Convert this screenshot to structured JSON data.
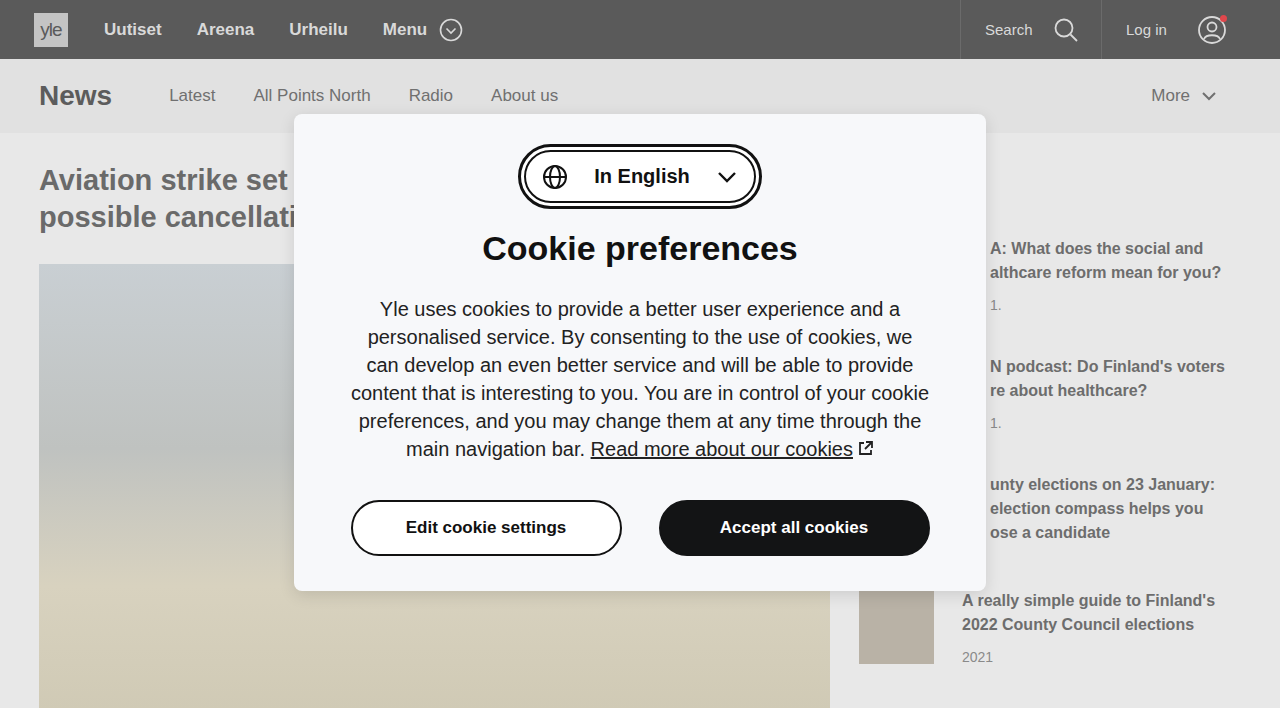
{
  "topbar": {
    "logo": "yle",
    "nav": [
      {
        "label": "Uutiset"
      },
      {
        "label": "Areena"
      },
      {
        "label": "Urheilu"
      }
    ],
    "menu": "Menu",
    "search": "Search",
    "login": {
      "label": "Log in",
      "notification": true
    }
  },
  "section": {
    "title": "News",
    "links": [
      "Latest",
      "All Points North",
      "Radio",
      "About us"
    ],
    "more": "More"
  },
  "article": {
    "headline": [
      "Aviation strike set",
      "possible cancellati"
    ]
  },
  "sidebar": {
    "items": [
      {
        "lines": [
          "A: What does the social and",
          "althcare reform mean for you?"
        ],
        "date": "1.",
        "covered": true
      },
      {
        "lines": [
          "N podcast: Do Finland's voters",
          "re about healthcare?"
        ],
        "date": "1.",
        "covered": true
      },
      {
        "lines": [
          "unty elections on 23 January:",
          "election compass helps you",
          "ose a candidate"
        ],
        "covered": true
      },
      {
        "lines": [
          "A really simple guide to Finland's",
          "2022 County Council elections"
        ],
        "date": "2021",
        "covered": false
      }
    ]
  },
  "dialog": {
    "language": "In English",
    "title": "Cookie preferences",
    "body": "Yle uses cookies to provide a better user experience and a personalised service. By consenting to the use of cookies, we can develop an even better service and will be able to provide content that is interesting to you. You are in control of your cookie preferences, and you may change them at any time through the main navigation bar.",
    "link": "Read more about our cookies",
    "buttons": [
      {
        "label": "Edit cookie settings",
        "primary": false
      },
      {
        "label": "Accept all cookies",
        "primary": true
      }
    ]
  }
}
